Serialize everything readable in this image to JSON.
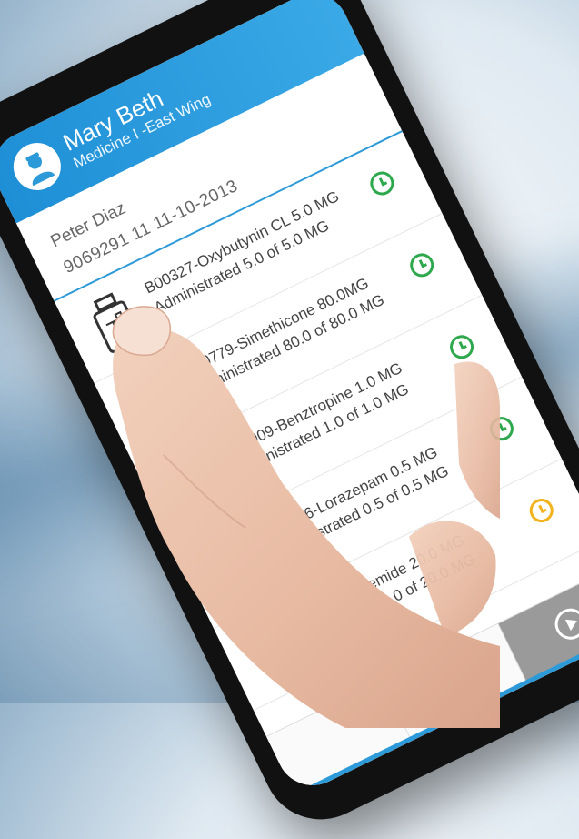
{
  "app": {
    "header": {
      "user_name": "Mary Beth",
      "unit": "Medicine I -East Wing"
    },
    "patient": {
      "name": "Peter Diaz",
      "info": "9069291  11  11-10-2013"
    },
    "medications": [
      {
        "name": "B00327-Oxybutynin CL 5.0 MG",
        "administered": "Administrated 5.0 of 5.0 MG",
        "status": "done"
      },
      {
        "name": "B00779-Simethicone 80.0MG",
        "administered": "Administrated 80.0 of 80.0 MG",
        "status": "done"
      },
      {
        "name": "B02909-Benztropine 1.0 MG",
        "administered": "Administrated 1.0 of 1.0 MG",
        "status": "done"
      },
      {
        "name": "B03336-Lorazepam 0.5 MG",
        "administered": "Administrated 0.5 of 0.5 MG",
        "status": "done"
      },
      {
        "name": "477-Furosemide 20.0 MG",
        "administered": "inistrated 10.0 of 20.0 MG",
        "status": "pending"
      }
    ],
    "icons": {
      "avatar": "nurse-avatar-icon",
      "bottle": "medicine-bottle-icon",
      "status_done": "clock-icon",
      "status_pending": "clock-icon",
      "clipboard": "patient-clipboard-icon",
      "next": "play-icon"
    },
    "colors": {
      "header": "#2c9ad8",
      "done": "#2ea84d",
      "pending": "#f2b21c"
    }
  }
}
